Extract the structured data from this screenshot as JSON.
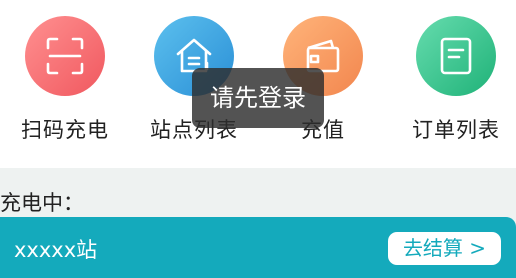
{
  "menu": {
    "items": [
      {
        "label": "扫码充电",
        "icon": "scan-icon",
        "color_from": "#ff8a8a",
        "color_to": "#f25f66"
      },
      {
        "label": "站点列表",
        "icon": "home-list-icon",
        "color_from": "#53b8ea",
        "color_to": "#2c93d8"
      },
      {
        "label": "充值",
        "icon": "wallet-icon",
        "color_from": "#ffad72",
        "color_to": "#f48a52"
      },
      {
        "label": "订单列表",
        "icon": "order-doc-icon",
        "color_from": "#5fd6a8",
        "color_to": "#22b57c"
      }
    ]
  },
  "toast": {
    "text": "请先登录"
  },
  "charging": {
    "title": "充电中：",
    "station_name": "xxxxx站",
    "settle_label": "去结算 >",
    "accent": "#14aabc"
  }
}
